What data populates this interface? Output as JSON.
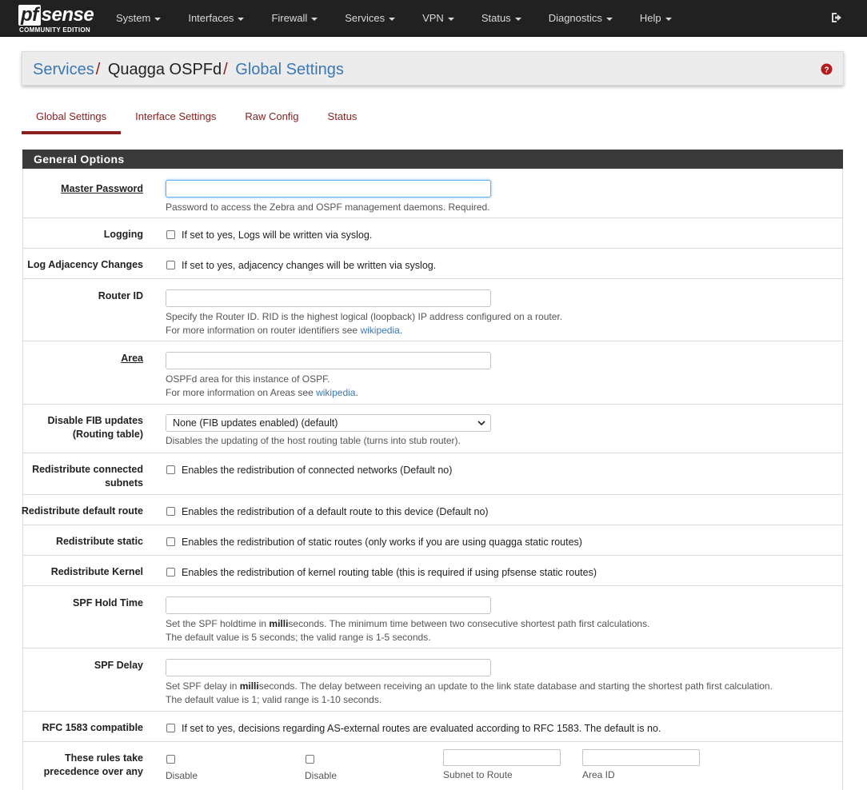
{
  "brand": {
    "logo_pf": "pf",
    "logo_sense": "sense",
    "edition": "COMMUNITY EDITION"
  },
  "nav": {
    "items": [
      {
        "label": "System"
      },
      {
        "label": "Interfaces"
      },
      {
        "label": "Firewall"
      },
      {
        "label": "Services"
      },
      {
        "label": "VPN"
      },
      {
        "label": "Status"
      },
      {
        "label": "Diagnostics"
      },
      {
        "label": "Help"
      }
    ],
    "logout_icon": "sign-out-icon"
  },
  "breadcrumb": {
    "part1": "Services",
    "sep": "/",
    "part2": "Quagga OSPFd",
    "part3": "Global Settings",
    "help_icon": "question-circle-icon"
  },
  "tabs": [
    "Global Settings",
    "Interface Settings",
    "Raw Config",
    "Status"
  ],
  "section": {
    "title": "General Options",
    "rows": {
      "master_password": {
        "label": "Master Password",
        "value": "",
        "help": "Password to access the Zebra and OSPF management daemons. Required."
      },
      "logging": {
        "label": "Logging",
        "text": "If set to yes, Logs will be written via syslog.",
        "checked": false
      },
      "log_adjacency": {
        "label": "Log Adjacency Changes",
        "text": "If set to yes, adjacency changes will be written via syslog.",
        "checked": false
      },
      "router_id": {
        "label": "Router ID",
        "value": "",
        "help1": "Specify the Router ID. RID is the highest logical (loopback) IP address configured on a router.",
        "help2_prefix": "For more information on router identifiers see ",
        "help2_link": "wikipedia",
        "help2_suffix": "."
      },
      "area": {
        "label": "Area",
        "value": "",
        "help1": "OSPFd area for this instance of OSPF.",
        "help2_prefix": "For more information on Areas see ",
        "help2_link": "wikipedia",
        "help2_suffix": "."
      },
      "disable_fib": {
        "label1": "Disable FIB updates",
        "label2": "(Routing table)",
        "selected": "None (FIB updates enabled) (default)",
        "help": "Disables the updating of the host routing table (turns into stub router)."
      },
      "redist_connected": {
        "label1": "Redistribute connected",
        "label2": "subnets",
        "text": "Enables the redistribution of connected networks (Default no)",
        "checked": false
      },
      "redist_default": {
        "label": "Redistribute default route",
        "text": "Enables the redistribution of a default route to this device (Default no)",
        "checked": false
      },
      "redist_static": {
        "label": "Redistribute static",
        "text": "Enables the redistribution of static routes (only works if you are using quagga static routes)",
        "checked": false
      },
      "redist_kernel": {
        "label": "Redistribute Kernel",
        "text": "Enables the redistribution of kernel routing table (this is required if using pfsense static routes)",
        "checked": false
      },
      "spf_hold": {
        "label": "SPF Hold Time",
        "value": "",
        "help1_pre": "Set the SPF holdtime in ",
        "help1_bold": "milli",
        "help1_post": "seconds. The minimum time between two consecutive shortest path first calculations.",
        "help2": "The default value is 5 seconds; the valid range is 1-5 seconds."
      },
      "spf_delay": {
        "label": "SPF Delay",
        "value": "",
        "help1_pre": "Set SPF delay in ",
        "help1_bold": "milli",
        "help1_post": "seconds. The delay between receiving an update to the link state database and starting the shortest path first calculation.",
        "help2": "The default value is 1; valid range is 1-10 seconds."
      },
      "rfc1583": {
        "label": "RFC 1583 compatible",
        "text": "If set to yes, decisions regarding AS-external routes are evaluated according to RFC 1583. The default is no.",
        "checked": false
      },
      "precedence": {
        "label1": "These rules take",
        "label2": "precedence over any",
        "col1": "Disable",
        "col2": "Disable",
        "col3": "Subnet to Route",
        "col4": "Area ID"
      }
    }
  }
}
